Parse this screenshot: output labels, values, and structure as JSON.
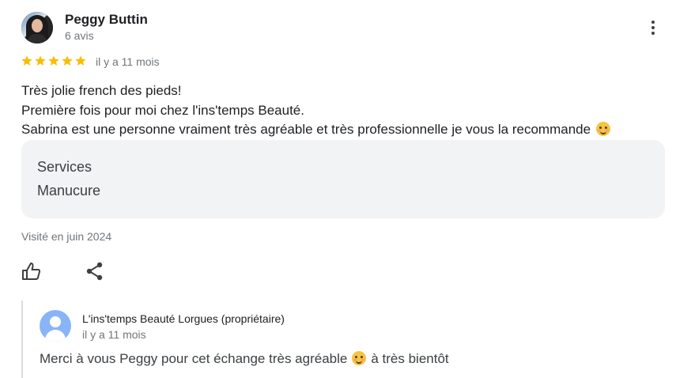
{
  "review": {
    "author_name": "Peggy Buttin",
    "author_meta": "6 avis",
    "rating": 5,
    "rating_max": 5,
    "time": "il y a 11 mois",
    "lines": [
      "Très jolie french des pieds!",
      "Première fois pour moi chez l'ins'temps Beauté.",
      "Sabrina est une personne vraiment très agréable et très professionnelle je vous la recommande"
    ],
    "services_title": "Services",
    "services_value": "Manucure",
    "visited": "Visité en juin 2024"
  },
  "icons": {
    "more": "more-vert-icon",
    "star": "star-icon",
    "like": "thumb-up-icon",
    "share": "share-icon",
    "emoji": "smiling-face-icon"
  },
  "reply": {
    "owner_name": "L'ins'temps Beauté Lorgues (propriétaire)",
    "owner_time": "il y a 11 mois",
    "text_before": "Merci à vous Peggy pour cet échange très agréable",
    "text_after": "à très bientôt"
  },
  "colors": {
    "star": "#fbbc04",
    "secondary_text": "#70757a",
    "box_bg": "#f1f3f4",
    "owner_avatar": "#8ab4f8"
  }
}
